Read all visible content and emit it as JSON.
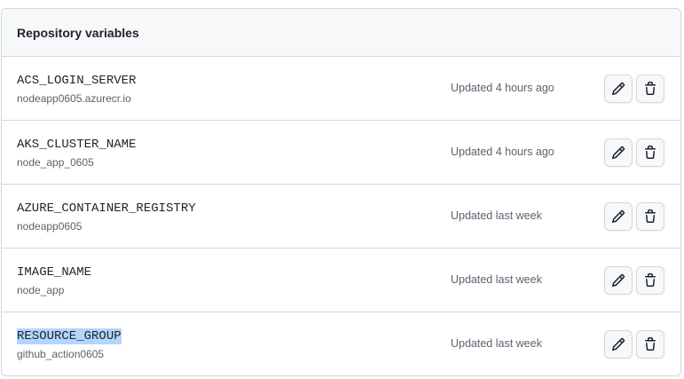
{
  "section": {
    "title": "Repository variables"
  },
  "variables": [
    {
      "name": "ACS_LOGIN_SERVER",
      "value": "nodeapp0605.azurecr.io",
      "updated": "Updated 4 hours ago",
      "selected": false
    },
    {
      "name": "AKS_CLUSTER_NAME",
      "value": "node_app_0605",
      "updated": "Updated 4 hours ago",
      "selected": false
    },
    {
      "name": "AZURE_CONTAINER_REGISTRY",
      "value": "nodeapp0605",
      "updated": "Updated last week",
      "selected": false
    },
    {
      "name": "IMAGE_NAME",
      "value": "node_app",
      "updated": "Updated last week",
      "selected": false
    },
    {
      "name": "RESOURCE_GROUP",
      "value": "github_action0605",
      "updated": "Updated last week",
      "selected": true
    }
  ],
  "icons": {
    "edit": "pencil-icon",
    "delete": "trash-icon"
  },
  "colors": {
    "border": "#d0d7de",
    "header_bg": "#f6f8fa",
    "muted_text": "#59636e",
    "selection": "#b4d5fe"
  }
}
